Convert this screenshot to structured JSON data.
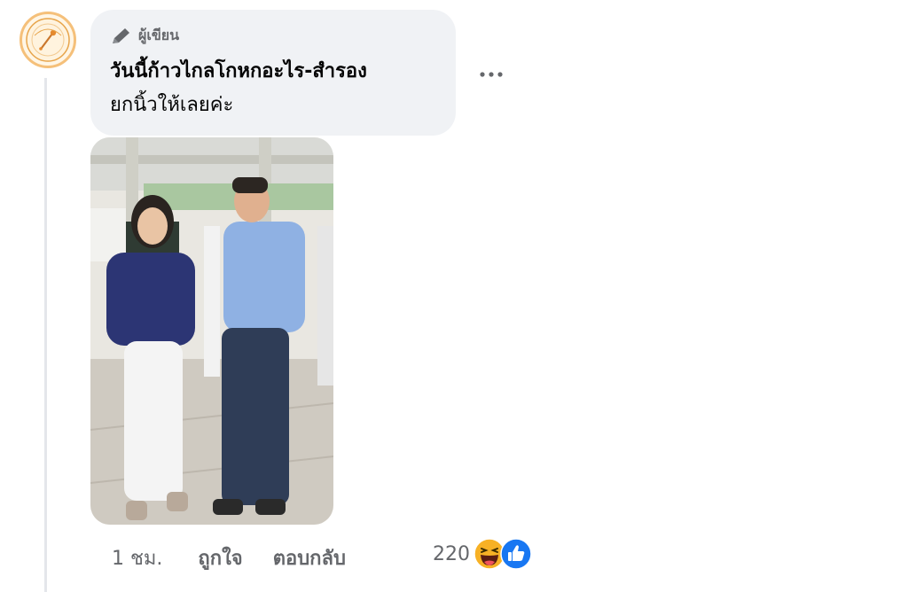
{
  "comment": {
    "author_badge": "ผู้เขียน",
    "text_line1": "วันนี้ก้าวไกลโกหกอะไร-สำรอง",
    "text_line2": "ยกนิ้วให้เลยค่ะ"
  },
  "actions": {
    "time": "1 ชม.",
    "like_label": "ถูกใจ",
    "reply_label": "ตอบกลับ",
    "reaction_count": "220"
  },
  "reactions": [
    "haha-icon",
    "like-icon"
  ],
  "colors": {
    "bubble": "#f0f2f5",
    "secondary_text": "#65676b",
    "like_blue": "#1877f2",
    "haha_yellow": "#f7b125"
  }
}
